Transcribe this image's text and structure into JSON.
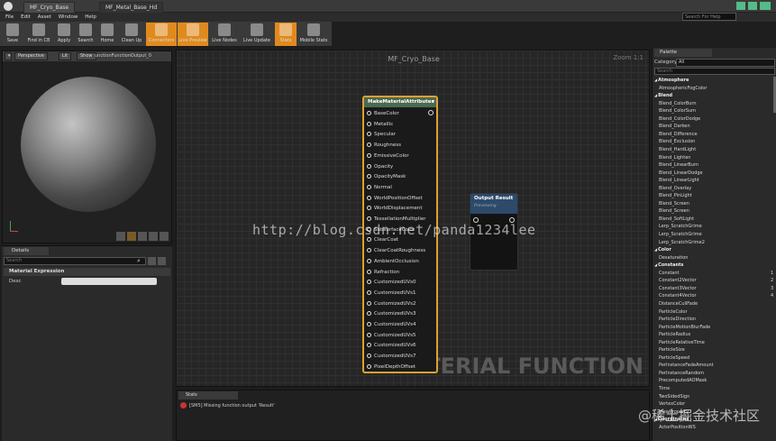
{
  "tabs": [
    "MF_Cryo_Base",
    "MF_Metal_Base_Hd"
  ],
  "menu": [
    "File",
    "Edit",
    "Asset",
    "Window",
    "Help"
  ],
  "search_help": "Search For Help",
  "toolbar": [
    {
      "label": "Save",
      "on": false
    },
    {
      "label": "Find in CB",
      "on": false
    },
    {
      "label": "Apply",
      "on": false
    },
    {
      "label": "Search",
      "on": false
    },
    {
      "label": "Home",
      "on": false
    },
    {
      "label": "Clean Up",
      "on": false
    },
    {
      "label": "Connectors",
      "on": true
    },
    {
      "label": "Live Preview",
      "on": true
    },
    {
      "label": "Live Nodes",
      "on": false
    },
    {
      "label": "Live Update",
      "on": false
    },
    {
      "label": "Stats",
      "on": true
    },
    {
      "label": "Mobile Stats",
      "on": false
    }
  ],
  "viewport": {
    "perspective": "Perspective",
    "lit": "Lit",
    "show": "Show",
    "output": "unctionFunctionOutput_0"
  },
  "details": {
    "tab": "Details",
    "search": "Search",
    "section": "Material Expression",
    "row": "Desc"
  },
  "graph": {
    "title": "MF_Cryo_Base",
    "zoom": "Zoom 1:1",
    "watermark": "MATERIAL FUNCTION"
  },
  "make_node": {
    "title": "MakeMaterialAttributes",
    "pins": [
      "BaseColor",
      "Metallic",
      "Specular",
      "Roughness",
      "EmissiveColor",
      "Opacity",
      "OpacityMask",
      "Normal",
      "WorldPositionOffset",
      "WorldDisplacement",
      "TessellationMultiplier",
      "SubsurfaceColor",
      "ClearCoat",
      "ClearCoatRoughness",
      "AmbientOcclusion",
      "Refraction",
      "CustomizedUVs0",
      "CustomizedUVs1",
      "CustomizedUVs2",
      "CustomizedUVs3",
      "CustomizedUVs4",
      "CustomizedUVs5",
      "CustomizedUVs6",
      "CustomizedUVs7",
      "PixelDepthOffset"
    ]
  },
  "output_node": {
    "title": "Output Result",
    "sub": "Previewing"
  },
  "stats": {
    "tab": "Stats",
    "message": "[SM5] Missing function output 'Result'"
  },
  "palette": {
    "tab": "Palette",
    "category_label": "Category",
    "category_value": "All",
    "search": "Search",
    "items": [
      {
        "t": "Atmosphere",
        "cat": true
      },
      {
        "t": "AtmosphericFogColor"
      },
      {
        "t": "Blend",
        "cat": true
      },
      {
        "t": "Blend_ColorBurn"
      },
      {
        "t": "Blend_ColorSum"
      },
      {
        "t": "Blend_ColorDodge"
      },
      {
        "t": "Blend_Darken"
      },
      {
        "t": "Blend_Difference"
      },
      {
        "t": "Blend_Exclusion"
      },
      {
        "t": "Blend_HardLight"
      },
      {
        "t": "Blend_Lighten"
      },
      {
        "t": "Blend_LinearBurn"
      },
      {
        "t": "Blend_LinearDodge"
      },
      {
        "t": "Blend_LinearLight"
      },
      {
        "t": "Blend_Overlay"
      },
      {
        "t": "Blend_PinLight"
      },
      {
        "t": "Blend_Screen"
      },
      {
        "t": "Blend_Screen"
      },
      {
        "t": "Blend_SoftLight"
      },
      {
        "t": "Lerp_ScratchGrime"
      },
      {
        "t": "Lerp_ScratchGrime"
      },
      {
        "t": "Lerp_ScratchGrime2"
      },
      {
        "t": "Color",
        "cat": true
      },
      {
        "t": "Desaturation"
      },
      {
        "t": "Constants",
        "cat": true
      },
      {
        "t": "Constant",
        "n": "1"
      },
      {
        "t": "Constant2Vector",
        "n": "2"
      },
      {
        "t": "Constant3Vector",
        "n": "3"
      },
      {
        "t": "Constant4Vector",
        "n": "4"
      },
      {
        "t": "DistanceCullFade"
      },
      {
        "t": "ParticleColor"
      },
      {
        "t": "ParticleDirection"
      },
      {
        "t": "ParticleMotionBlurFade"
      },
      {
        "t": "ParticleRadius"
      },
      {
        "t": "ParticleRelativeTime"
      },
      {
        "t": "ParticleSize"
      },
      {
        "t": "ParticleSpeed"
      },
      {
        "t": "PerInstanceFadeAmount"
      },
      {
        "t": "PerInstanceRandom"
      },
      {
        "t": "PrecomputedAOMask"
      },
      {
        "t": "Time"
      },
      {
        "t": "TwoSidedSign"
      },
      {
        "t": "VertexColor"
      },
      {
        "t": "ViewProperty"
      },
      {
        "t": "Coordinates",
        "cat": true
      },
      {
        "t": "ActorPositionWS"
      }
    ]
  },
  "watermark": "http://blog.csdn.net/panda1234lee",
  "watermark2": "@稀土掘金技术社区"
}
